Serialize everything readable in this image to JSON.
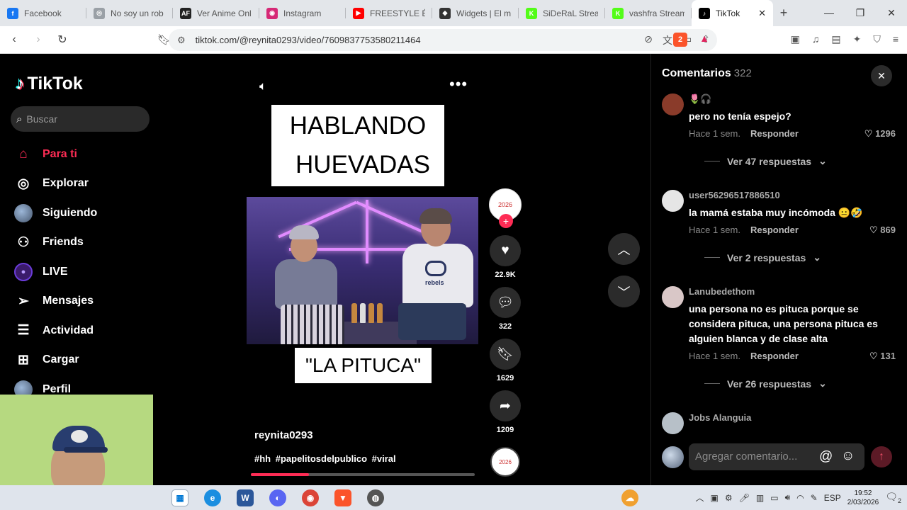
{
  "browser": {
    "tabs": [
      {
        "title": "Facebook",
        "color": "#1877f2",
        "glyph": "f"
      },
      {
        "title": "No soy un rob",
        "color": "#9aa0a6",
        "glyph": "◎"
      },
      {
        "title": "Ver Anime Onl",
        "color": "#222222",
        "glyph": "AF"
      },
      {
        "title": "Instagram",
        "color": "#d62976",
        "glyph": "◉"
      },
      {
        "title": "FREESTYLE ÉP",
        "color": "#ff0000",
        "glyph": "▶"
      },
      {
        "title": "Widgets | El m",
        "color": "#333333",
        "glyph": "◆"
      },
      {
        "title": "SiDeRaL Stream",
        "color": "#53fc18",
        "glyph": "K"
      },
      {
        "title": "vashfra Stream",
        "color": "#53fc18",
        "glyph": "K"
      }
    ],
    "active_tab": {
      "title": "TikTok"
    },
    "url": "tiktok.com/@reynita0293/video/7609837753580211464",
    "brave_badge": "2"
  },
  "sidebar": {
    "brand": "TikTok",
    "search_placeholder": "Buscar",
    "items": [
      {
        "label": "Para ti",
        "icon": "home-icon",
        "glyph": "⌂",
        "active": true
      },
      {
        "label": "Explorar",
        "icon": "compass-icon",
        "glyph": "◎"
      },
      {
        "label": "Siguiendo",
        "icon": "following-avatar",
        "glyph": ""
      },
      {
        "label": "Friends",
        "icon": "friends-icon",
        "glyph": "⚇"
      },
      {
        "label": "LIVE",
        "icon": "live-icon",
        "glyph": "●"
      },
      {
        "label": "Mensajes",
        "icon": "send-icon",
        "glyph": "➢"
      },
      {
        "label": "Actividad",
        "icon": "activity-icon",
        "glyph": "☰"
      },
      {
        "label": "Cargar",
        "icon": "upload-icon",
        "glyph": "⊞"
      },
      {
        "label": "Perfil",
        "icon": "profile-avatar",
        "glyph": ""
      }
    ]
  },
  "video": {
    "title_line1": "HABLANDO",
    "title_line2": "HUEVADAS",
    "tag_text": "\"LA PITUCA\"",
    "author": "reynita0293",
    "hashtags": "#hh #papelitosdelpublico #viral",
    "progress": 0.26,
    "scene_brand": "rebels"
  },
  "actions": {
    "likes": "22.9K",
    "comments": "322",
    "saves": "1629",
    "shares": "1209"
  },
  "comments_panel": {
    "title": "Comentarios",
    "count": "322",
    "input_placeholder": "Agregar comentario...",
    "items": [
      {
        "user": "🌷🎧",
        "text": "pero no tenía espejo?",
        "time": "Hace 1 sem.",
        "reply": "Responder",
        "likes": "1296",
        "view_replies": "Ver 47 respuestas",
        "avatar_color": "#8a3b2a"
      },
      {
        "user": "user56296517886510",
        "text": "la mamá estaba muy incómoda 😐🤣",
        "time": "Hace 1 sem.",
        "reply": "Responder",
        "likes": "869",
        "view_replies": "Ver 2 respuestas",
        "avatar_color": "#e5e5e5"
      },
      {
        "user": "Lanubedethom",
        "text": "una persona no es pituca porque se considera pituca, una persona pituca es alguien blanca y de clase alta",
        "time": "Hace 1 sem.",
        "reply": "Responder",
        "likes": "131",
        "view_replies": "Ver 26 respuestas",
        "avatar_color": "#d9c7c7"
      },
      {
        "user": "Jobs Alanguia",
        "text": "",
        "time": "",
        "reply": "",
        "likes": "",
        "view_replies": "",
        "avatar_color": "#b7c0c8"
      }
    ]
  },
  "taskbar": {
    "language": "ESP",
    "time": "19:52",
    "date": "2/03/2026",
    "notifications": "2"
  }
}
